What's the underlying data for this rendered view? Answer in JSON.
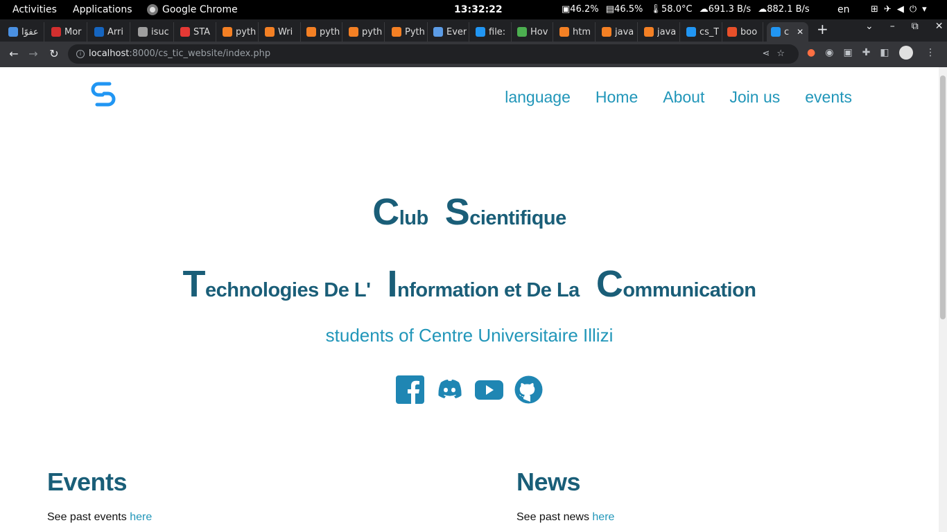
{
  "system_bar": {
    "activities": "Activities",
    "applications": "Applications",
    "app_name": "Google Chrome",
    "clock": "13:32:22",
    "stats": [
      "46.2%",
      "46.5%",
      "58.0°C",
      "691.3 B/s",
      "882.1 B/s"
    ],
    "language": "en"
  },
  "browser": {
    "tabs": [
      {
        "label": "عفوًا",
        "color": "#4a90e2"
      },
      {
        "label": "Mor",
        "color": "#d32f2f"
      },
      {
        "label": "Arri",
        "color": "#1565c0"
      },
      {
        "label": "isuc",
        "color": "#9e9e9e"
      },
      {
        "label": "STA",
        "color": "#e53935"
      },
      {
        "label": "pyth",
        "color": "#f48024"
      },
      {
        "label": "Wri",
        "color": "#f48024"
      },
      {
        "label": "pyth",
        "color": "#f48024"
      },
      {
        "label": "pyth",
        "color": "#f48024"
      },
      {
        "label": "Pyth",
        "color": "#f48024"
      },
      {
        "label": "Ever",
        "color": "#5c9ce6"
      },
      {
        "label": "file:",
        "color": "#2196f3"
      },
      {
        "label": "Hov",
        "color": "#4caf50"
      },
      {
        "label": "htm",
        "color": "#f48024"
      },
      {
        "label": "java",
        "color": "#f48024"
      },
      {
        "label": "java",
        "color": "#f48024"
      },
      {
        "label": "cs_T",
        "color": "#2196f3"
      },
      {
        "label": "boo",
        "color": "#e8502a"
      },
      {
        "label": "c",
        "color": "#2196f3"
      }
    ],
    "url_host": "localhost",
    "url_path": ":8000/cs_tic_website/index.php"
  },
  "site": {
    "nav": [
      "language",
      "Home",
      "About",
      "Join us",
      "events"
    ],
    "hero": {
      "l1": [
        {
          "big": "C",
          "rest": "lub"
        },
        {
          "big": "S",
          "rest": "cientifique"
        }
      ],
      "l2": [
        {
          "big": "T",
          "rest": "echnologies De L'"
        },
        {
          "big": "I",
          "rest": "nformation et De La"
        },
        {
          "big": "C",
          "rest": "ommunication"
        }
      ]
    },
    "subtitle": "students of Centre Universitaire Illizi",
    "events": {
      "title": "Events",
      "text": "See past events ",
      "link": "here"
    },
    "news": {
      "title": "News",
      "text": "See past news ",
      "link": "here"
    },
    "accent": "#2196b9",
    "dark": "#1a5e78"
  }
}
